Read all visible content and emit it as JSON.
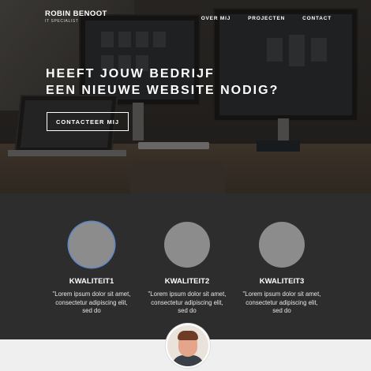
{
  "header": {
    "brand_name": "ROBIN BENOOT",
    "brand_subtitle": "IT SPECIALIST",
    "nav": [
      {
        "label": "OVER MIJ"
      },
      {
        "label": "PROJECTEN"
      },
      {
        "label": "CONTACT"
      }
    ]
  },
  "hero": {
    "headline_line1": "HEEFT JOUW BEDRIJF",
    "headline_line2": "EEN NIEUWE WEBSITE NODIG?",
    "cta_label": "CONTACTEER MIJ"
  },
  "qualities": [
    {
      "title": "KWALITEIT1",
      "text": "\"Lorem ipsum dolor sit amet, consectetur adipiscing elit, sed do"
    },
    {
      "title": "KWALITEIT2",
      "text": "\"Lorem ipsum dolor sit amet, consectetur adipiscing elit, sed do"
    },
    {
      "title": "KWALITEIT3",
      "text": "\"Lorem ipsum dolor sit amet, consectetur adipiscing elit, sed do"
    }
  ],
  "colors": {
    "hero_overlay": "#2a2622",
    "section_bg": "#2d2d2d",
    "circle": "#8c8c8c",
    "focus_ring": "#5c86c9",
    "bottom_bg": "#efefef"
  }
}
